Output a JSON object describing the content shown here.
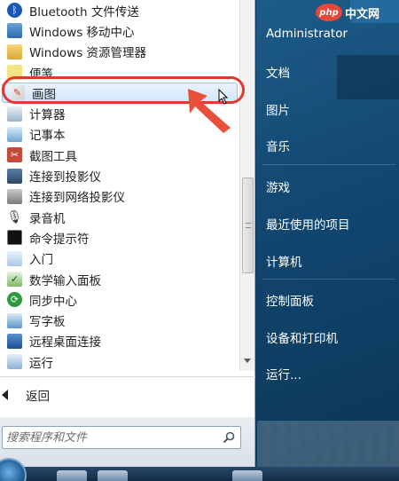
{
  "start_menu": {
    "programs": [
      {
        "label": "Bluetooth 文件传送",
        "icon": "bluetooth-icon"
      },
      {
        "label": "Windows 移动中心",
        "icon": "mobility-center-icon"
      },
      {
        "label": "Windows 资源管理器",
        "icon": "explorer-folder-icon"
      },
      {
        "label": "便笺",
        "icon": "sticky-notes-icon"
      },
      {
        "label": "画图",
        "icon": "paint-icon"
      },
      {
        "label": "计算器",
        "icon": "calculator-icon"
      },
      {
        "label": "记事本",
        "icon": "notepad-icon"
      },
      {
        "label": "截图工具",
        "icon": "snipping-tool-icon"
      },
      {
        "label": "连接到投影仪",
        "icon": "projector-icon"
      },
      {
        "label": "连接到网络投影仪",
        "icon": "network-projector-icon"
      },
      {
        "label": "录音机",
        "icon": "sound-recorder-icon"
      },
      {
        "label": "命令提示符",
        "icon": "command-prompt-icon"
      },
      {
        "label": "入门",
        "icon": "getting-started-icon"
      },
      {
        "label": "数学输入面板",
        "icon": "math-input-icon"
      },
      {
        "label": "同步中心",
        "icon": "sync-center-icon"
      },
      {
        "label": "写字板",
        "icon": "wordpad-icon"
      },
      {
        "label": "远程桌面连接",
        "icon": "remote-desktop-icon"
      },
      {
        "label": "运行",
        "icon": "run-icon"
      }
    ],
    "selected_index": 4,
    "back_label": "返回",
    "search_placeholder": "搜索程序和文件"
  },
  "right_pane": {
    "user": "Administrator",
    "items": [
      "文档",
      "图片",
      "音乐",
      "游戏",
      "最近使用的项目",
      "计算机",
      "控制面板",
      "设备和打印机",
      "运行..."
    ]
  },
  "watermark": {
    "logo": "php",
    "text": "中文网"
  },
  "colors": {
    "highlight": "#e03a2e",
    "right_pane": "#114670",
    "selection": "#d3e6fb"
  }
}
